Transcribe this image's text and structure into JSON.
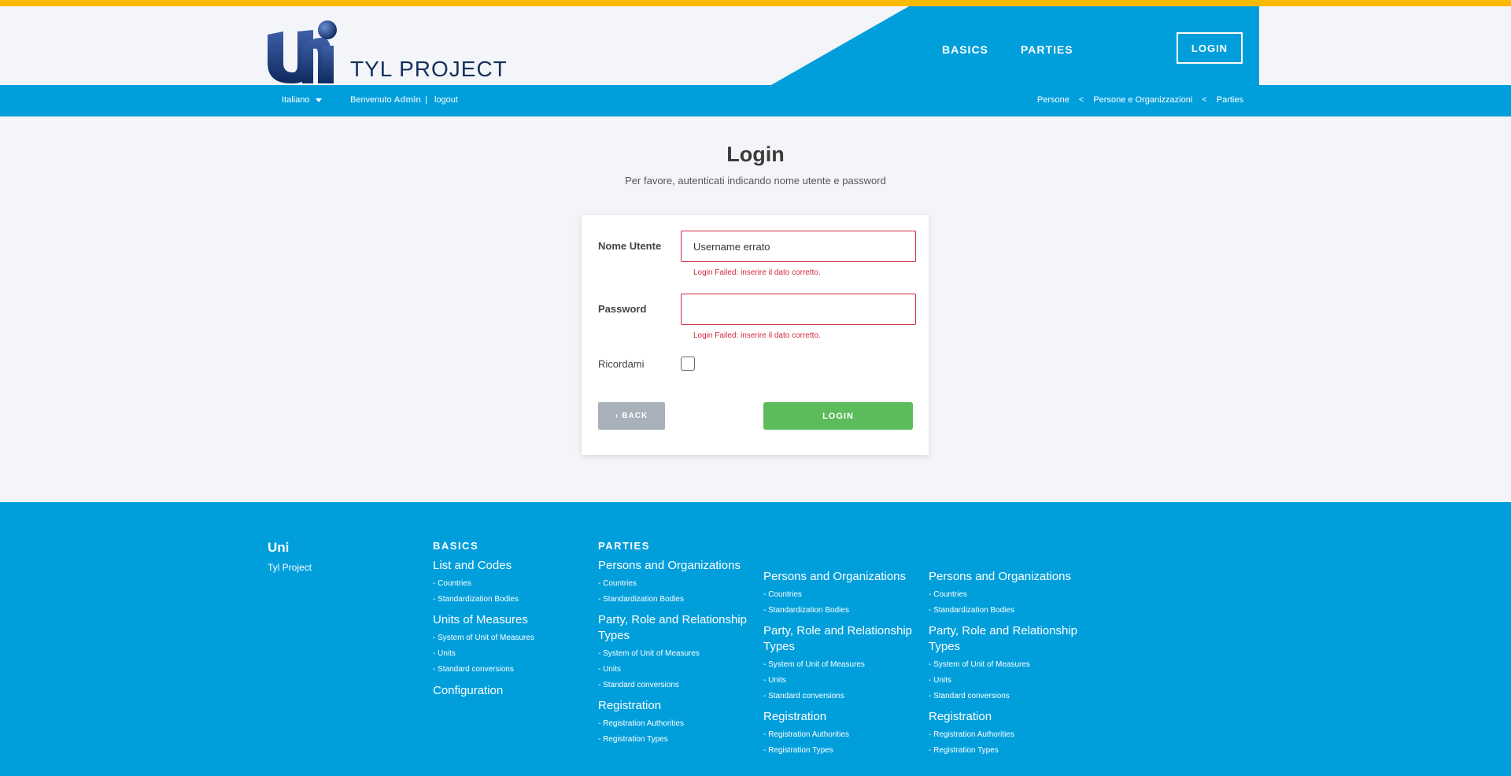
{
  "colors": {
    "accent_yellow": "#fbb900",
    "brand_blue": "#009fdc",
    "error_red": "#d0283f",
    "login_green": "#5cbb5a",
    "back_gray": "#a8b1ba"
  },
  "header": {
    "logo_icon": "uni-logo",
    "logo_text": "TYL PROJECT",
    "nav": [
      "BASICS",
      "PARTIES"
    ],
    "login_label": "LOGIN"
  },
  "subbar": {
    "language": "Italiano",
    "welcome": "Benvenuto",
    "user": "Admin",
    "separator": "|",
    "logout": "logout",
    "breadcrumb": [
      "Persone",
      "Persone e Organizzazioni",
      "Parties"
    ],
    "breadcrumb_sep": "<"
  },
  "main": {
    "title": "Login",
    "subtitle": "Per favore, autenticati indicando nome utente e password"
  },
  "form": {
    "username_label": "Nome Utente",
    "username_value": "Username errato",
    "username_error": "Login Failed: inserire il dato corretto.",
    "password_label": "Password",
    "password_value": "",
    "password_error": "Login Failed: inserire il dato corretto.",
    "remember_label": "Ricordami",
    "remember_checked": false,
    "back_label": "BACK",
    "submit_label": "LOGIN"
  },
  "footer": {
    "brand": "Uni",
    "brand_sub": "Tyl Project",
    "basics": {
      "heading": "BASICS",
      "sections": [
        {
          "title": "List and Codes",
          "links": [
            "- Countries",
            "- Standardization Bodies"
          ]
        },
        {
          "title": "Units of Measures",
          "links": [
            "- System of Unit of Measures",
            "- Units",
            "- Standard conversions"
          ]
        }
      ],
      "config": "Configuration"
    },
    "parties": {
      "heading": "PARTIES",
      "columns": [
        [
          {
            "title": "Persons and Organizations",
            "links": [
              "- Countries",
              "- Standardization Bodies"
            ]
          },
          {
            "title": "Party, Role and Relationship Types",
            "links": [
              "- System of Unit of Measures",
              "- Units",
              "- Standard conversions"
            ]
          },
          {
            "title": "Registration",
            "links": [
              "- Registration Authorities",
              "- Registration Types"
            ]
          }
        ],
        [
          {
            "title": "Persons and Organizations",
            "links": [
              "- Countries",
              "- Standardization Bodies"
            ]
          },
          {
            "title": "Party, Role and Relationship Types",
            "links": [
              "- System of Unit of Measures",
              "- Units",
              "- Standard conversions"
            ]
          },
          {
            "title": "Registration",
            "links": [
              "- Registration Authorities",
              "- Registration Types"
            ]
          }
        ],
        [
          {
            "title": "Persons and Organizations",
            "links": [
              "- Countries",
              "- Standardization Bodies"
            ]
          },
          {
            "title": "Party, Role and Relationship Types",
            "links": [
              "- System of Unit of Measures",
              "- Units",
              "- Standard conversions"
            ]
          },
          {
            "title": "Registration",
            "links": [
              "- Registration Authorities",
              "- Registration Types"
            ]
          }
        ]
      ]
    }
  }
}
